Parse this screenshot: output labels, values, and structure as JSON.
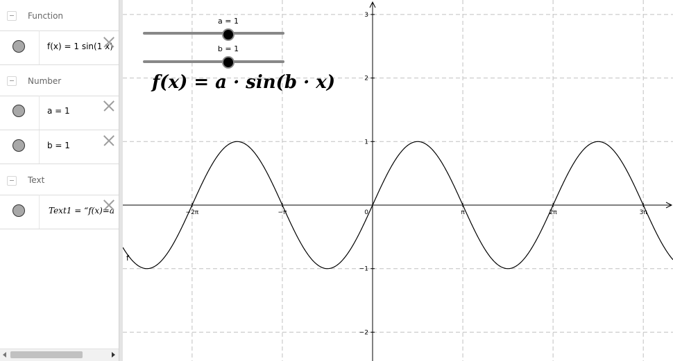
{
  "algebra_view": {
    "groups": [
      {
        "label": "Function",
        "items": [
          {
            "text": "f(x) = 1 sin(1 x)"
          }
        ]
      },
      {
        "label": "Number",
        "items": [
          {
            "text": "a = 1"
          },
          {
            "text": "b = 1"
          }
        ]
      },
      {
        "label": "Text",
        "items": [
          {
            "text": "Text1 = “f(x)=a"
          }
        ]
      }
    ]
  },
  "graphics_view": {
    "sliders": [
      {
        "label": "a = 1",
        "value": 1
      },
      {
        "label": "b = 1",
        "value": 1
      }
    ],
    "formula_text": "f(x) = a · sin(b · x)",
    "curve_label": "f",
    "x_ticks": [
      "−2π",
      "−π",
      "0",
      "π",
      "2π",
      "3π"
    ],
    "y_ticks": [
      "3",
      "2",
      "1",
      "−1",
      "−2"
    ],
    "colors": {
      "curve": "#000000",
      "grid": "#c0c0c0",
      "axes": "#000000"
    }
  },
  "chart_data": {
    "type": "line",
    "title": "",
    "series": [
      {
        "name": "f",
        "function": "1 sin(1 x)",
        "x": [
          -8.1,
          -4.712,
          -1.571,
          0,
          1.571,
          4.712,
          7.854,
          10.0
        ],
        "y": [
          -0.97,
          1,
          -1,
          0,
          1,
          -1,
          1,
          -0.544
        ]
      }
    ],
    "x_ticks": [
      "−2π",
      "−π",
      "0",
      "π",
      "2π",
      "3π"
    ],
    "y_ticks": [
      "3",
      "2",
      "1",
      "−1",
      "−2"
    ],
    "xlim": [
      -8.7,
      10.2
    ],
    "ylim": [
      -2.4,
      3.2
    ],
    "grid": true
  }
}
